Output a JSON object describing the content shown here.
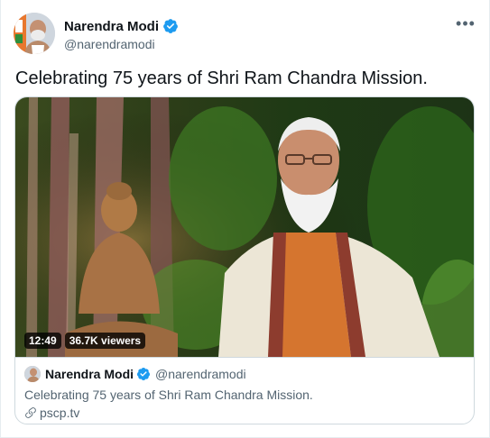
{
  "author": {
    "name": "Narendra Modi",
    "handle": "@narendramodi",
    "verified_icon": "verified-badge-icon",
    "avatar_icon": "avatar-photo"
  },
  "more_icon": "more-horizontal-icon",
  "tweet_text": "Celebrating 75 years of Shri Ram Chandra Mission.",
  "media": {
    "duration": "12:49",
    "viewers": "36.7K viewers"
  },
  "card": {
    "name": "Narendra Modi",
    "handle": "@narendramodi",
    "text": "Celebrating 75 years of Shri Ram Chandra Mission.",
    "link": "pscp.tv",
    "link_icon": "link-icon"
  },
  "colors": {
    "verified_blue": "#1d9bf0",
    "secondary_text": "#536471",
    "border": "#cfd9de"
  }
}
